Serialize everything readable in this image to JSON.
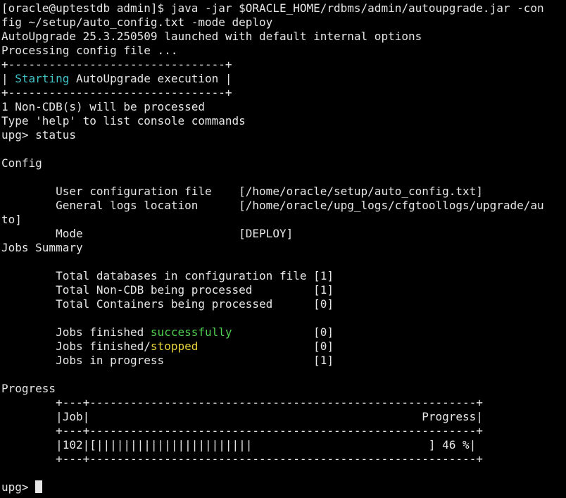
{
  "colors": {
    "background": "#000000",
    "foreground": "#e6e6e6",
    "cyan": "#41c2c6",
    "green": "#4fd04f",
    "yellow": "#e6d33a"
  },
  "terminal": {
    "lines": [
      {
        "name": "command-line-1",
        "segments": [
          {
            "text": "[oracle@uptestdb admin]$ java -jar $ORACLE_HOME/rdbms/admin/autoupgrade.jar -con"
          }
        ]
      },
      {
        "name": "command-line-2",
        "segments": [
          {
            "text": "fig ~/setup/auto_config.txt -mode deploy"
          }
        ]
      },
      {
        "name": "launch-message",
        "segments": [
          {
            "text": "AutoUpgrade 25.3.250509 launched with default internal options"
          }
        ]
      },
      {
        "name": "processing-message",
        "segments": [
          {
            "text": "Processing config file ..."
          }
        ]
      },
      {
        "name": "banner-border-top",
        "segments": [
          {
            "text": "+--------------------------------+"
          }
        ]
      },
      {
        "name": "banner-text",
        "segments": [
          {
            "text": "| "
          },
          {
            "text": "Starting",
            "color": "cyan"
          },
          {
            "text": " AutoUpgrade execution |"
          }
        ]
      },
      {
        "name": "banner-border-bottom",
        "segments": [
          {
            "text": "+--------------------------------+"
          }
        ]
      },
      {
        "name": "noncdb-count-message",
        "segments": [
          {
            "text": "1 Non-CDB(s) will be processed"
          }
        ]
      },
      {
        "name": "help-hint",
        "segments": [
          {
            "text": "Type 'help' to list console commands"
          }
        ]
      },
      {
        "name": "status-command",
        "segments": [
          {
            "text": "upg> status"
          }
        ]
      },
      {
        "name": "blank-line",
        "segments": [
          {
            "text": ""
          }
        ]
      },
      {
        "name": "config-heading",
        "segments": [
          {
            "text": "Config"
          }
        ]
      },
      {
        "name": "blank-line",
        "segments": [
          {
            "text": ""
          }
        ]
      },
      {
        "name": "user-config-file-row",
        "segments": [
          {
            "text": "        User configuration file    [/home/oracle/setup/auto_config.txt]"
          }
        ]
      },
      {
        "name": "general-logs-row",
        "segments": [
          {
            "text": "        General logs location      [/home/oracle/upg_logs/cfgtoollogs/upgrade/au"
          }
        ]
      },
      {
        "name": "general-logs-row-wrap",
        "segments": [
          {
            "text": "to]"
          }
        ]
      },
      {
        "name": "mode-row",
        "segments": [
          {
            "text": "        Mode                       [DEPLOY]"
          }
        ]
      },
      {
        "name": "jobs-summary-heading",
        "segments": [
          {
            "text": "Jobs Summary"
          }
        ]
      },
      {
        "name": "blank-line",
        "segments": [
          {
            "text": ""
          }
        ]
      },
      {
        "name": "total-databases-row",
        "segments": [
          {
            "text": "        Total databases in configuration file [1]"
          }
        ]
      },
      {
        "name": "total-noncdb-row",
        "segments": [
          {
            "text": "        Total Non-CDB being processed         [1]"
          }
        ]
      },
      {
        "name": "total-containers-row",
        "segments": [
          {
            "text": "        Total Containers being processed      [0]"
          }
        ]
      },
      {
        "name": "blank-line",
        "segments": [
          {
            "text": ""
          }
        ]
      },
      {
        "name": "jobs-successful-row",
        "segments": [
          {
            "text": "        Jobs finished "
          },
          {
            "text": "successfully",
            "color": "green"
          },
          {
            "text": "            [0]"
          }
        ]
      },
      {
        "name": "jobs-stopped-row",
        "segments": [
          {
            "text": "        Jobs finished/"
          },
          {
            "text": "stopped",
            "color": "yellow"
          },
          {
            "text": "                 [0]"
          }
        ]
      },
      {
        "name": "jobs-in-progress-row",
        "segments": [
          {
            "text": "        Jobs in progress                      [1]"
          }
        ]
      },
      {
        "name": "blank-line",
        "segments": [
          {
            "text": ""
          }
        ]
      },
      {
        "name": "progress-heading",
        "segments": [
          {
            "text": "Progress"
          }
        ]
      },
      {
        "name": "progress-table-border-top",
        "segments": [
          {
            "text": "        +---+---------------------------------------------------------+"
          }
        ]
      },
      {
        "name": "progress-table-header",
        "segments": [
          {
            "text": "        |Job|                                                 Progress|"
          }
        ]
      },
      {
        "name": "progress-table-border-mid",
        "segments": [
          {
            "text": "        +---+---------------------------------------------------------+"
          }
        ]
      },
      {
        "name": "progress-table-row-102",
        "segments": [
          {
            "text": "        |102|[|||||||||||||||||||||||                          ] 46 %|"
          }
        ]
      },
      {
        "name": "progress-table-border-bottom",
        "segments": [
          {
            "text": "        +---+---------------------------------------------------------+"
          }
        ]
      },
      {
        "name": "blank-line",
        "segments": [
          {
            "text": ""
          }
        ]
      },
      {
        "name": "prompt-line",
        "segments": [
          {
            "text": "upg> "
          }
        ],
        "cursor": true
      }
    ]
  },
  "progress": {
    "job": "102",
    "percent": 46
  }
}
